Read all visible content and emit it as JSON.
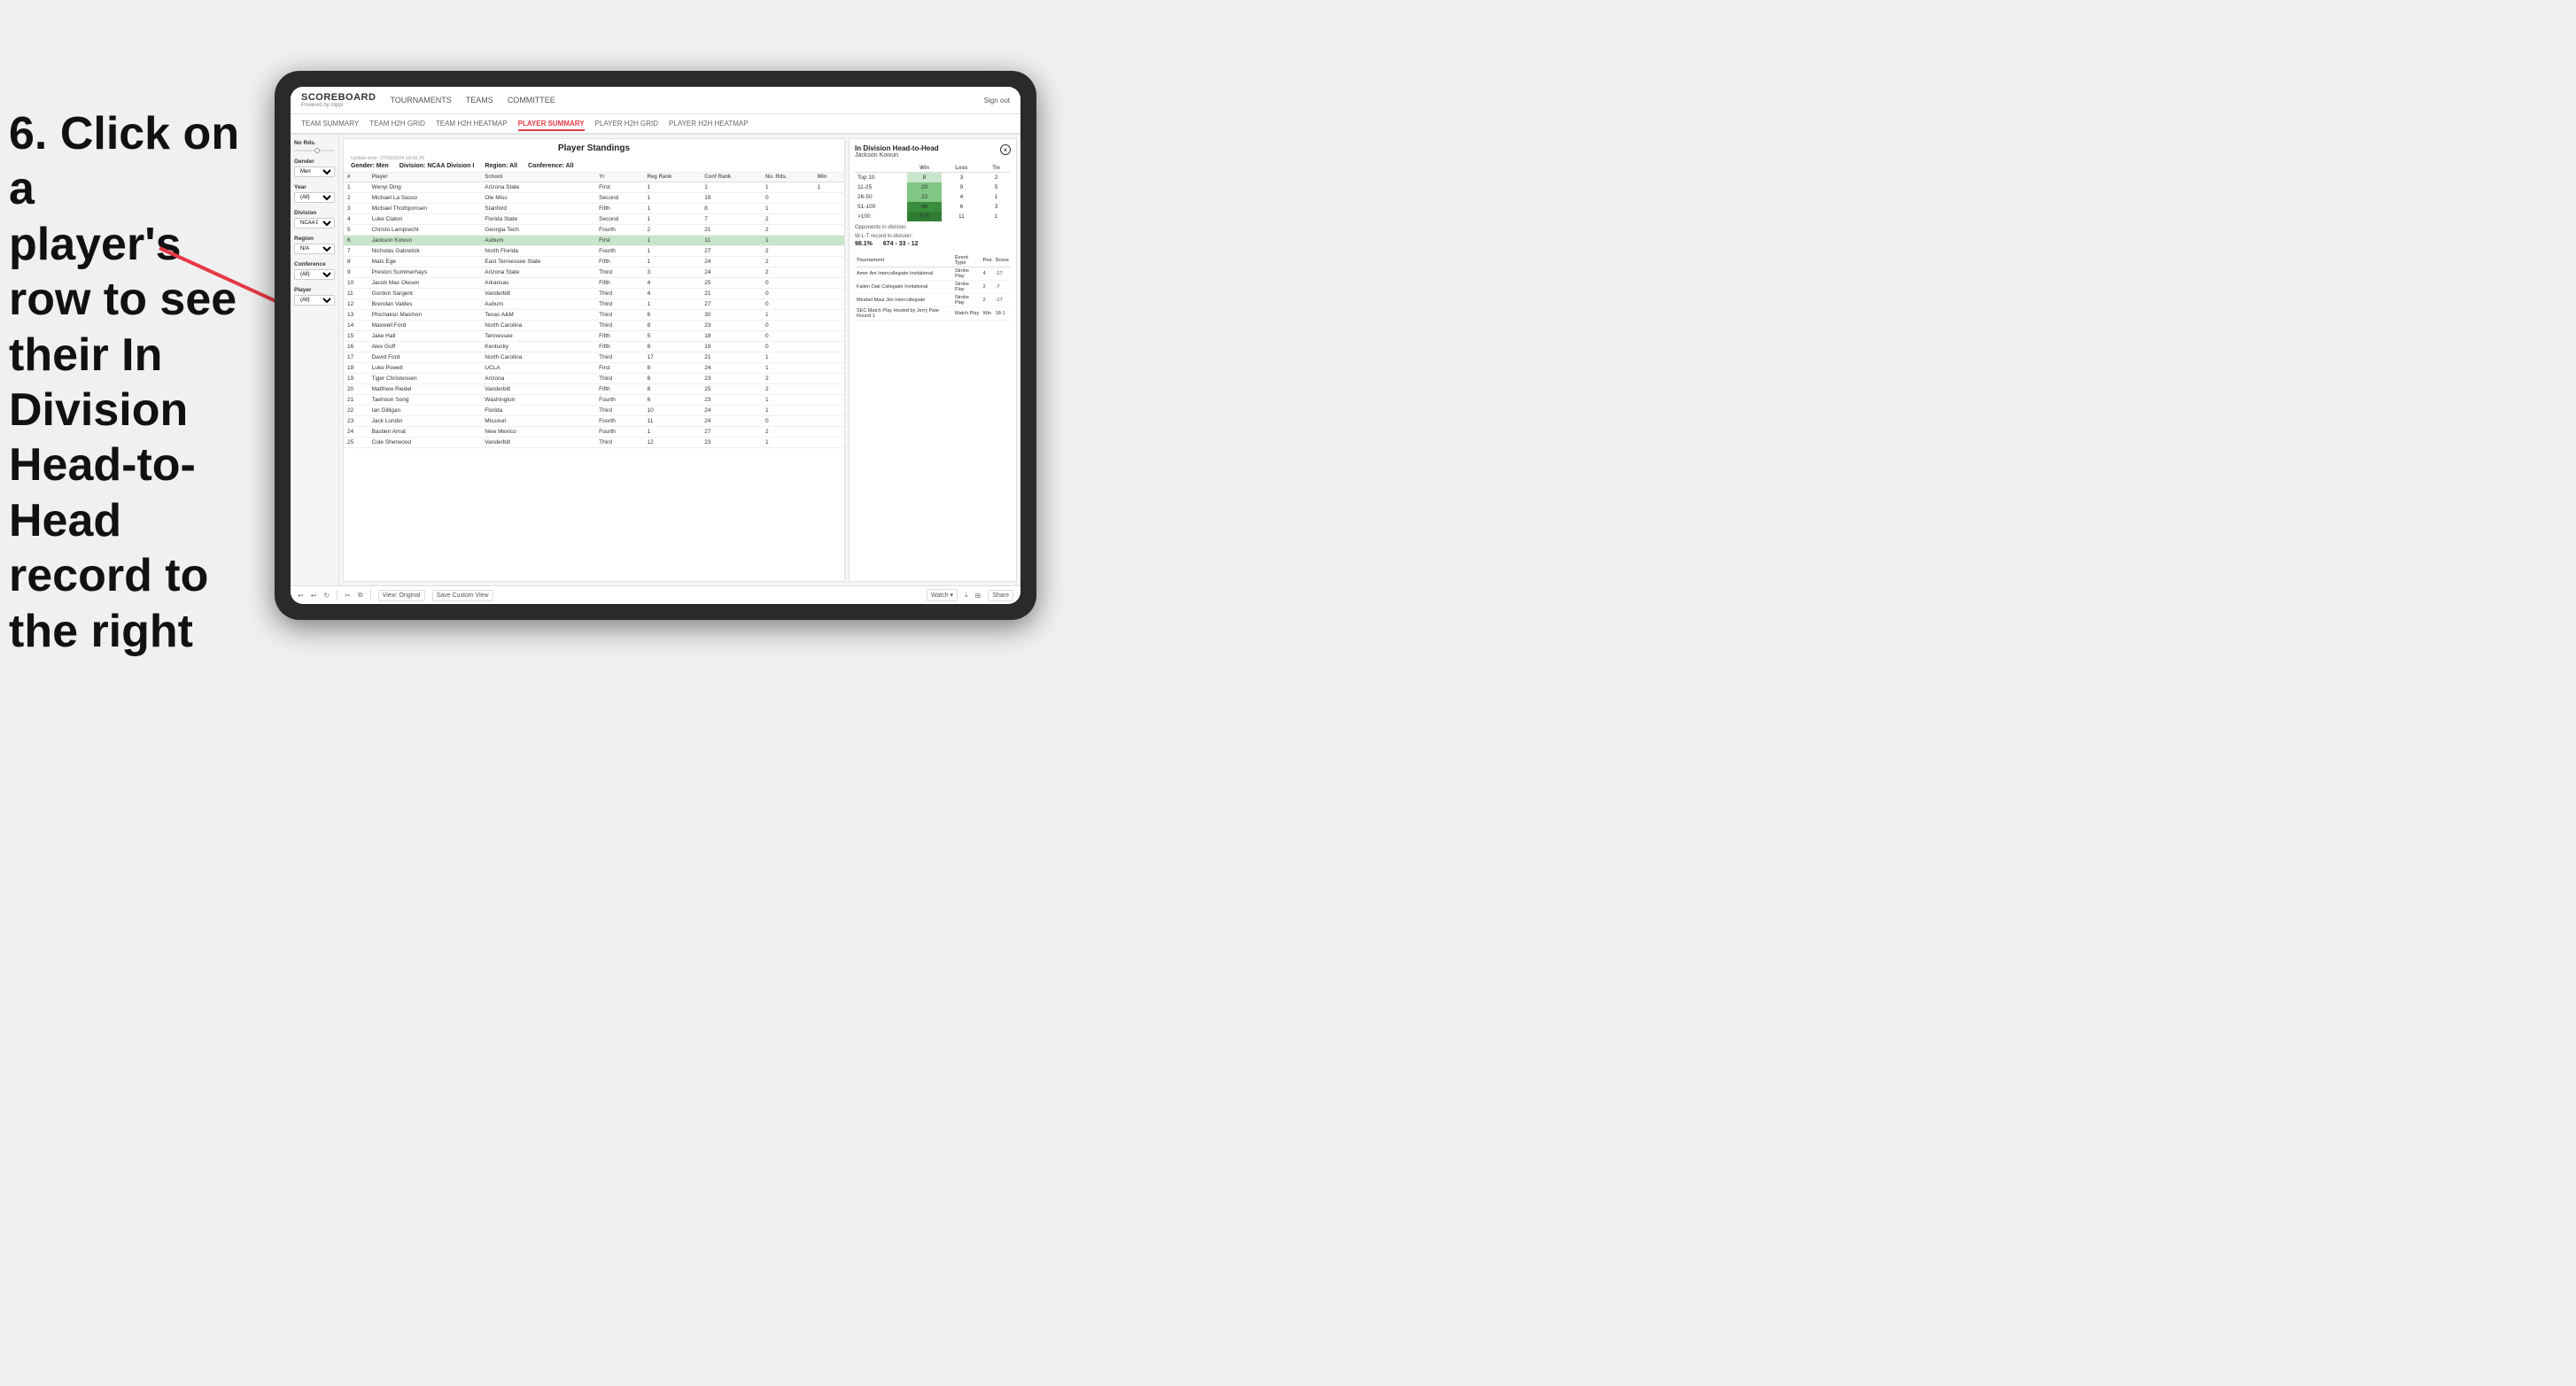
{
  "instruction": {
    "line1": "6. Click on a",
    "line2": "player's row to see",
    "line3": "their In Division",
    "line4": "Head-to-Head",
    "line5": "record to the right"
  },
  "header": {
    "logo_title": "SCOREBOARD",
    "logo_sub": "Powered by clippi",
    "nav_items": [
      "TOURNAMENTS",
      "TEAMS",
      "COMMITTEE"
    ],
    "sign_out": "Sign out"
  },
  "sub_nav": {
    "items": [
      "TEAM SUMMARY",
      "TEAM H2H GRID",
      "TEAM H2H HEATMAP",
      "PLAYER SUMMARY",
      "PLAYER H2H GRID",
      "PLAYER H2H HEATMAP"
    ],
    "active": "PLAYER SUMMARY"
  },
  "sidebar": {
    "no_rds_label": "No Rds.",
    "gender_label": "Gender",
    "gender_value": "Men",
    "year_label": "Year",
    "year_value": "(All)",
    "division_label": "Division",
    "division_value": "NCAA Division I",
    "region_label": "Region",
    "region_value": "N/A",
    "conference_label": "Conference",
    "conference_value": "(All)",
    "player_label": "Player",
    "player_value": "(All)"
  },
  "standings": {
    "title": "Player Standings",
    "update_time": "Update time:",
    "update_date": "27/03/2024 16:56:26",
    "gender_label": "Gender:",
    "gender_value": "Men",
    "division_label": "Division:",
    "division_value": "NCAA Division I",
    "region_label": "Region:",
    "region_value": "All",
    "conference_label": "Conference:",
    "conference_value": "All",
    "columns": [
      "#",
      "Player",
      "School",
      "Yr",
      "Reg Rank",
      "Conf Rank",
      "No. Rds.",
      "Win"
    ],
    "rows": [
      {
        "num": "1",
        "player": "Wenyi Ding",
        "school": "Arizona State",
        "yr": "First",
        "reg": "1",
        "conf": "1",
        "rds": "1",
        "win": "1"
      },
      {
        "num": "2",
        "player": "Michael La Sasso",
        "school": "Ole Miss",
        "yr": "Second",
        "reg": "1",
        "conf": "19",
        "rds": "0",
        "win": ""
      },
      {
        "num": "3",
        "player": "Michael Thorbjornsen",
        "school": "Stanford",
        "yr": "Fifth",
        "reg": "1",
        "conf": "8",
        "rds": "1",
        "win": ""
      },
      {
        "num": "4",
        "player": "Luke Claton",
        "school": "Florida State",
        "yr": "Second",
        "reg": "1",
        "conf": "7",
        "rds": "2",
        "win": ""
      },
      {
        "num": "5",
        "player": "Christo Lamprecht",
        "school": "Georgia Tech",
        "yr": "Fourth",
        "reg": "2",
        "conf": "21",
        "rds": "2",
        "win": ""
      },
      {
        "num": "6",
        "player": "Jackson Koivun",
        "school": "Auburn",
        "yr": "First",
        "reg": "1",
        "conf": "11",
        "rds": "1",
        "win": "",
        "highlighted": true
      },
      {
        "num": "7",
        "player": "Nicholas Gabrelcik",
        "school": "North Florida",
        "yr": "Fourth",
        "reg": "1",
        "conf": "27",
        "rds": "2",
        "win": ""
      },
      {
        "num": "8",
        "player": "Mats Ege",
        "school": "East Tennessee State",
        "yr": "Fifth",
        "reg": "1",
        "conf": "24",
        "rds": "2",
        "win": ""
      },
      {
        "num": "9",
        "player": "Preston Summerhays",
        "school": "Arizona State",
        "yr": "Third",
        "reg": "3",
        "conf": "24",
        "rds": "2",
        "win": ""
      },
      {
        "num": "10",
        "player": "Jacob Max Olesen",
        "school": "Arkansas",
        "yr": "Fifth",
        "reg": "4",
        "conf": "25",
        "rds": "0",
        "win": ""
      },
      {
        "num": "11",
        "player": "Gordon Sargent",
        "school": "Vanderbilt",
        "yr": "Third",
        "reg": "4",
        "conf": "21",
        "rds": "0",
        "win": ""
      },
      {
        "num": "12",
        "player": "Brendan Valdes",
        "school": "Auburn",
        "yr": "Third",
        "reg": "1",
        "conf": "27",
        "rds": "0",
        "win": ""
      },
      {
        "num": "13",
        "player": "Phichaksn Maichon",
        "school": "Texas A&M",
        "yr": "Third",
        "reg": "6",
        "conf": "30",
        "rds": "1",
        "win": ""
      },
      {
        "num": "14",
        "player": "Maxwell Ford",
        "school": "North Carolina",
        "yr": "Third",
        "reg": "8",
        "conf": "23",
        "rds": "0",
        "win": ""
      },
      {
        "num": "15",
        "player": "Jake Hall",
        "school": "Tennessee",
        "yr": "Fifth",
        "reg": "5",
        "conf": "18",
        "rds": "0",
        "win": ""
      },
      {
        "num": "16",
        "player": "Alex Goff",
        "school": "Kentucky",
        "yr": "Fifth",
        "reg": "8",
        "conf": "19",
        "rds": "0",
        "win": ""
      },
      {
        "num": "17",
        "player": "David Ford",
        "school": "North Carolina",
        "yr": "Third",
        "reg": "17",
        "conf": "21",
        "rds": "1",
        "win": ""
      },
      {
        "num": "18",
        "player": "Luke Powell",
        "school": "UCLA",
        "yr": "First",
        "reg": "8",
        "conf": "24",
        "rds": "1",
        "win": ""
      },
      {
        "num": "19",
        "player": "Tiger Christensen",
        "school": "Arizona",
        "yr": "Third",
        "reg": "8",
        "conf": "23",
        "rds": "2",
        "win": ""
      },
      {
        "num": "20",
        "player": "Matthew Riedel",
        "school": "Vanderbilt",
        "yr": "Fifth",
        "reg": "8",
        "conf": "25",
        "rds": "2",
        "win": ""
      },
      {
        "num": "21",
        "player": "Taehoon Song",
        "school": "Washington",
        "yr": "Fourth",
        "reg": "6",
        "conf": "23",
        "rds": "1",
        "win": ""
      },
      {
        "num": "22",
        "player": "Ian Gilligan",
        "school": "Florida",
        "yr": "Third",
        "reg": "10",
        "conf": "24",
        "rds": "1",
        "win": ""
      },
      {
        "num": "23",
        "player": "Jack Lundin",
        "school": "Missouri",
        "yr": "Fourth",
        "reg": "11",
        "conf": "24",
        "rds": "0",
        "win": ""
      },
      {
        "num": "24",
        "player": "Bastien Amat",
        "school": "New Mexico",
        "yr": "Fourth",
        "reg": "1",
        "conf": "27",
        "rds": "2",
        "win": ""
      },
      {
        "num": "25",
        "player": "Cole Sherwood",
        "school": "Vanderbilt",
        "yr": "Third",
        "reg": "12",
        "conf": "23",
        "rds": "1",
        "win": ""
      }
    ]
  },
  "h2h": {
    "title": "In Division Head-to-Head",
    "player_name": "Jackson Koivun",
    "close_btn": "×",
    "win_label": "Win",
    "loss_label": "Loss",
    "tie_label": "Tie",
    "rows": [
      {
        "range": "Top 10",
        "win": "8",
        "loss": "3",
        "tie": "2"
      },
      {
        "range": "11-25",
        "win": "20",
        "loss": "9",
        "tie": "5"
      },
      {
        "range": "26-50",
        "win": "22",
        "loss": "4",
        "tie": "1"
      },
      {
        "range": "51-100",
        "win": "46",
        "loss": "6",
        "tie": "3"
      },
      {
        "range": ">100",
        "win": "578",
        "loss": "11",
        "tie": "1"
      }
    ],
    "opponents_label": "Opponents in division:",
    "wlt_label": "W-L-T record in-division:",
    "opponents_pct": "98.1%",
    "wlt_record": "674 - 33 - 12",
    "tournament_cols": [
      "Tournament",
      "Event Type",
      "Pos",
      "Score"
    ],
    "tournaments": [
      {
        "name": "Amer Am Intercollegiate Invitational",
        "type": "Stroke Play",
        "pos": "4",
        "score": "-17"
      },
      {
        "name": "Fallen Oak Collegiate Invitational",
        "type": "Stroke Play",
        "pos": "2",
        "score": "-7"
      },
      {
        "name": "Mirabel Maui Jim Intercollegiate",
        "type": "Stroke Play",
        "pos": "2",
        "score": "-17"
      },
      {
        "name": "SEC Match Play Hosted by Jerry Pate Round 1",
        "type": "Match Play",
        "pos": "Win",
        "score": "18-1"
      }
    ]
  },
  "toolbar": {
    "view_original": "View: Original",
    "save_custom": "Save Custom View",
    "watch": "Watch ▾",
    "share": "Share"
  }
}
